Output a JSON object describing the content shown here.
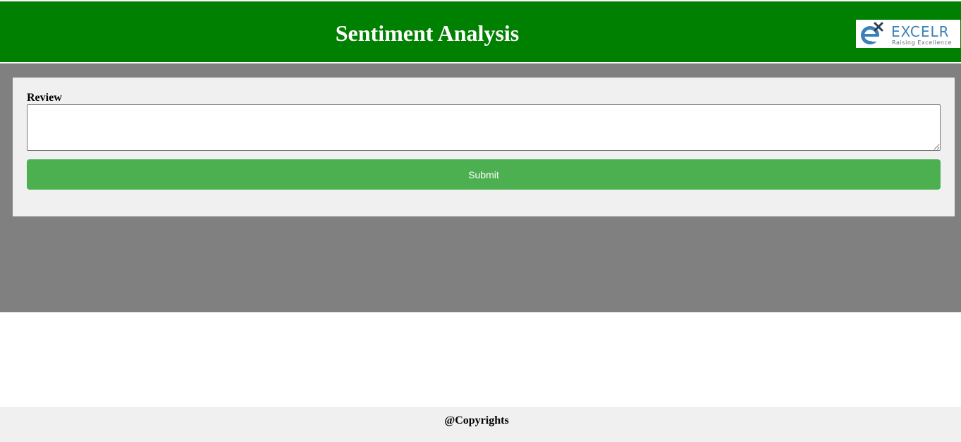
{
  "header": {
    "title": "Sentiment Analysis",
    "logo": {
      "icon": "excelr-logo-icon",
      "wordmark": "EXCELR",
      "tagline": "Raising Excellence"
    }
  },
  "form": {
    "review_label": "Review",
    "review_value": "",
    "submit_label": "Submit"
  },
  "footer": {
    "text": "@Copyrights"
  },
  "colors": {
    "header_bg": "#008000",
    "main_bg": "#808080",
    "card_bg": "#f0f0f0",
    "submit_bg": "#4caf50",
    "footer_bg": "#f0f0f0"
  }
}
